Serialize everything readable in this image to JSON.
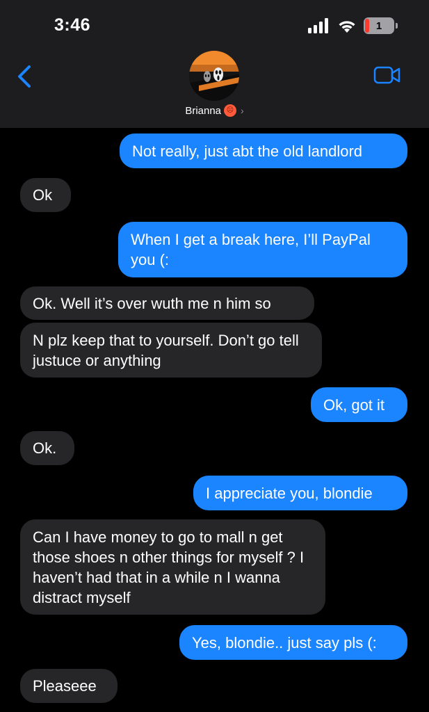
{
  "status_bar": {
    "time": "3:46",
    "battery_level": "1"
  },
  "contact": {
    "name": "Brianna",
    "chevron": "›"
  },
  "icons": {
    "back": "chevron-left-icon",
    "video": "video-camera-icon",
    "signal": "cellular-signal-icon",
    "wifi": "wifi-icon",
    "battery": "battery-icon"
  },
  "colors": {
    "outgoing_bubble": "#1b84ff",
    "incoming_bubble": "#262629",
    "accent": "#1b84ff"
  },
  "messages": [
    {
      "from": "me",
      "text": "Not really, just abt the old landlord"
    },
    {
      "from": "them",
      "text": "Ok"
    },
    {
      "from": "me",
      "text": "When I get a break here, I’ll PayPal you (:"
    },
    {
      "from": "them",
      "text": "Ok. Well it’s over wuth me n him so"
    },
    {
      "from": "them",
      "text": "N plz keep that to yourself. Don’t go tell justuce or anything"
    },
    {
      "from": "me",
      "text": "Ok, got it"
    },
    {
      "from": "them",
      "text": "Ok."
    },
    {
      "from": "me",
      "text": "I appreciate you, blondie"
    },
    {
      "from": "them",
      "text": "Can I have money to go to mall n get those shoes n other things for myself ? I haven’t had that in a while n I wanna distract myself"
    },
    {
      "from": "me",
      "text": "Yes, blondie.. just say pls (:"
    },
    {
      "from": "them",
      "text": "Pleaseee"
    }
  ]
}
